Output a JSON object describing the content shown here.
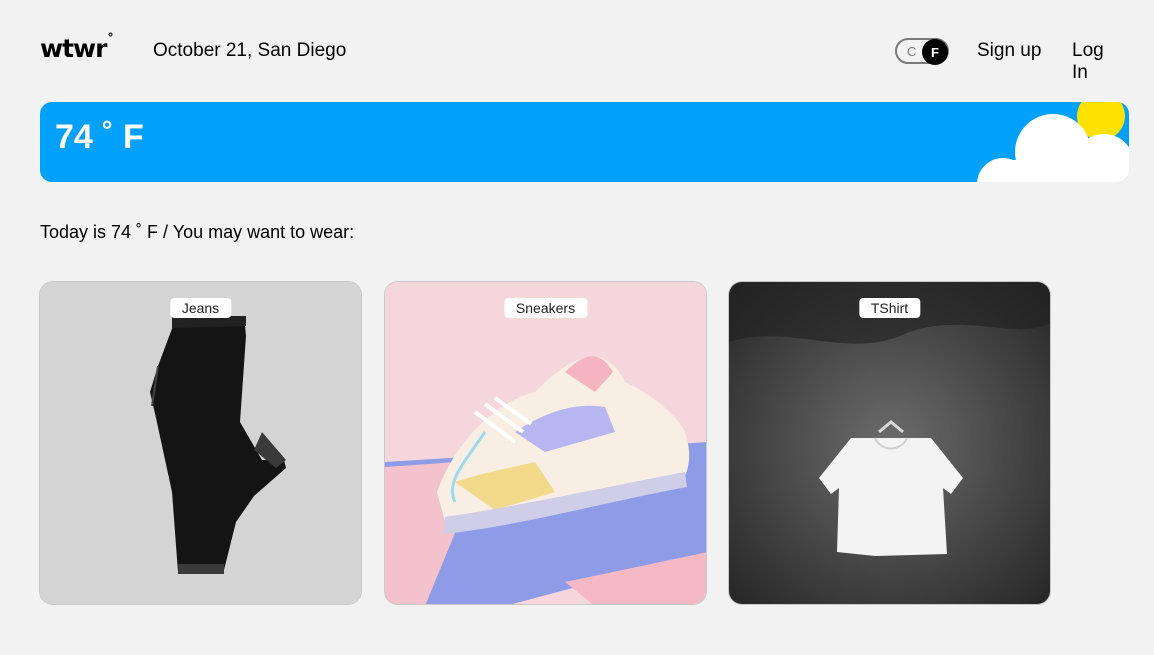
{
  "header": {
    "logo": "wtwr",
    "logo_mark": "°",
    "date_location": "October 21, San Diego",
    "unit_toggle": {
      "off_label": "C",
      "on_label": "F",
      "selected": "F"
    },
    "signup_label": "Sign up",
    "login_label": "Log In"
  },
  "weather": {
    "temperature": "74 ˚ F",
    "condition_icons": [
      "sun-icon",
      "cloud-icon"
    ],
    "banner_color": "#00a0fb"
  },
  "main": {
    "caption": "Today is 74 ˚ F / You may want to wear:",
    "items": [
      {
        "name": "Jeans",
        "image": "black-jeans-image"
      },
      {
        "name": "Sneakers",
        "image": "pastel-sneakers-image"
      },
      {
        "name": "TShirt",
        "image": "white-tshirt-image"
      }
    ]
  }
}
